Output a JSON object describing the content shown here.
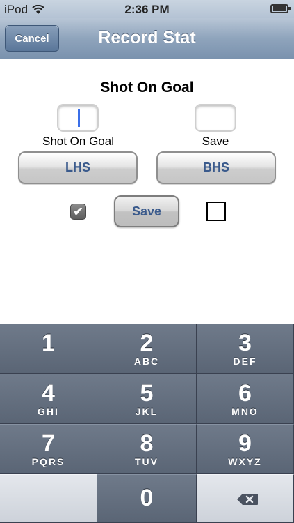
{
  "status_bar": {
    "carrier": "iPod",
    "time": "2:36 PM",
    "icons": [
      "wifi-icon",
      "battery-charging-icon"
    ]
  },
  "nav": {
    "title": "Record Stat",
    "cancel_label": "Cancel"
  },
  "form": {
    "heading": "Shot On Goal",
    "left_field": {
      "label": "Shot On Goal",
      "value": ""
    },
    "right_field": {
      "label": "Save",
      "value": ""
    },
    "team_buttons": [
      "LHS",
      "BHS"
    ],
    "save_label": "Save",
    "left_checkbox_checked": true,
    "right_checkbox_checked": false
  },
  "keypad": {
    "keys": [
      {
        "digit": "1",
        "letters": ""
      },
      {
        "digit": "2",
        "letters": "ABC"
      },
      {
        "digit": "3",
        "letters": "DEF"
      },
      {
        "digit": "4",
        "letters": "GHI"
      },
      {
        "digit": "5",
        "letters": "JKL"
      },
      {
        "digit": "6",
        "letters": "MNO"
      },
      {
        "digit": "7",
        "letters": "PQRS"
      },
      {
        "digit": "8",
        "letters": "TUV"
      },
      {
        "digit": "9",
        "letters": "WXYZ"
      },
      {
        "digit": "0",
        "letters": ""
      }
    ],
    "backspace_icon": "backspace-icon"
  },
  "colors": {
    "accent_text": "#3a5a8c",
    "cursor": "#3b6fe8",
    "nav_bar": "#8fa4bc"
  }
}
